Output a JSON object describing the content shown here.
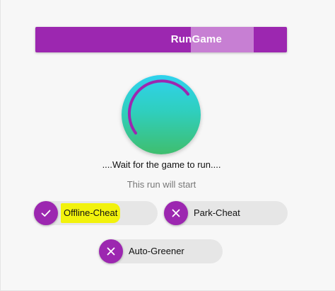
{
  "run_button": {
    "label": "RunGame",
    "progress_fraction": 0.25
  },
  "status": {
    "wait_text": "....Wait for the game to run....",
    "sub_text": "This run will start"
  },
  "options": [
    {
      "label": "Offline-Cheat",
      "state": "checked",
      "icon": "check-icon",
      "highlighted": true
    },
    {
      "label": "Park-Cheat",
      "state": "unchecked",
      "icon": "close-icon",
      "highlighted": false
    },
    {
      "label": "Auto-Greener",
      "state": "unchecked",
      "icon": "close-icon",
      "highlighted": false
    }
  ],
  "colors": {
    "accent": "#9c27b0",
    "progress": "#c77fd3",
    "orb_top": "#2fd2ee",
    "orb_bottom": "#3fbe6e",
    "highlight": "#f2f20c"
  }
}
